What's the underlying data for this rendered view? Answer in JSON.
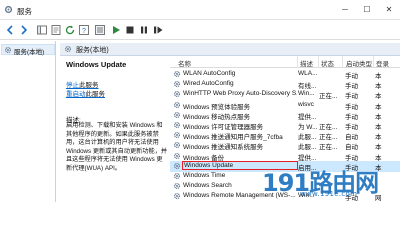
{
  "window": {
    "title": "服务",
    "minimize": "─",
    "maximize": "☐",
    "close": "✕"
  },
  "tree": {
    "item": "服务(本地)"
  },
  "header": {
    "label": "服务(本地)"
  },
  "details": {
    "title": "Windows Update",
    "stop_link": "停止",
    "stop_suffix": "此服务",
    "restart_link": "重启动",
    "restart_suffix": "此服务",
    "description_label": "描述:",
    "description_text": "启用检测、下载和安装 Windows 和其他程序的更新。如果此服务被禁用，这台计算机的用户将无法使用 Windows 更新或其自动更新功能，并且这些程序将无法使用 Windows 更新代理(WUA) API。"
  },
  "columns": {
    "name": "名称",
    "description": "描述",
    "status": "状态",
    "startup": "启动类型",
    "logon": "登录"
  },
  "rows": [
    {
      "name": "WLAN AutoConfig",
      "desc": "WLA...",
      "status": "",
      "startup": "手动",
      "logon": "本"
    },
    {
      "name": "Wired AutoConfig",
      "desc": "有线...",
      "status": "",
      "startup": "手动",
      "logon": "本"
    },
    {
      "name": "WinHTTP Web Proxy Auto-Discovery S...",
      "desc": "Win...",
      "status": "正在...",
      "startup": "手动",
      "logon": "本"
    },
    {
      "name": "Windows 预览体验服务",
      "desc": "wisvc",
      "status": "",
      "startup": "手动",
      "logon": "本"
    },
    {
      "name": "Windows 移动热点服务",
      "desc": "提供...",
      "status": "",
      "startup": "手动",
      "logon": "本"
    },
    {
      "name": "Windows 许可证管理器服务",
      "desc": "为 W...",
      "status": "正在...",
      "startup": "手动",
      "logon": "本"
    },
    {
      "name": "Windows 推送通知用户服务_7cfba",
      "desc": "此服...",
      "status": "正在...",
      "startup": "自动",
      "logon": "本"
    },
    {
      "name": "Windows 推送通知系统服务",
      "desc": "此服...",
      "status": "正在...",
      "startup": "自动",
      "logon": "本"
    },
    {
      "name": "Windows 备份",
      "desc": "提供...",
      "status": "",
      "startup": "手动",
      "logon": "本"
    },
    {
      "name": "Windows Update",
      "desc": "启用...",
      "status": "",
      "startup": "手动",
      "logon": "本"
    },
    {
      "name": "Windows Time",
      "desc": "",
      "status": "",
      "startup": "",
      "logon": ""
    },
    {
      "name": "Windows Search",
      "desc": "",
      "status": "",
      "startup": "",
      "logon": ""
    },
    {
      "name": "Windows Remote Management (WS-...",
      "desc": "Win...",
      "status": "",
      "startup": "手动",
      "logon": "网"
    }
  ],
  "selected_row": "Windows Update",
  "watermark": {
    "text": "191路由网",
    "url": "www.191e.com"
  },
  "colors": {
    "accent": "#0066cc",
    "selection": "#cce8ff",
    "highlight_box": "#e31e24",
    "watermark": "#1e73be"
  }
}
